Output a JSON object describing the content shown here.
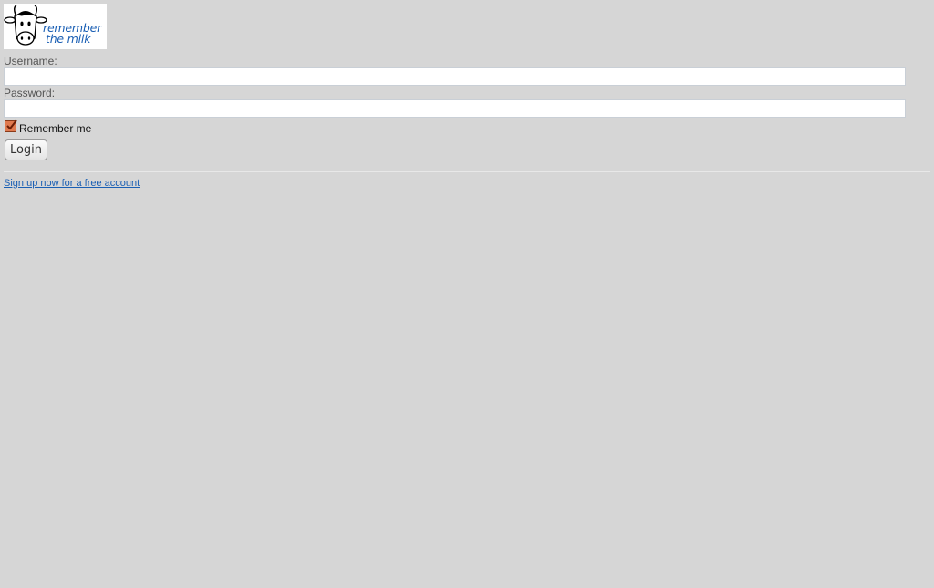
{
  "brand": {
    "logo_line1": "remember",
    "logo_line2": "the milk",
    "logo_icon": "cow-icon",
    "color": "#1a5fb4"
  },
  "login_form": {
    "username_label": "Username:",
    "username_value": "",
    "password_label": "Password:",
    "password_value": "",
    "remember_label": "Remember me",
    "remember_checked": true,
    "submit_label": "Login"
  },
  "footer": {
    "signup_link": "Sign up now for a free account"
  },
  "colors": {
    "background": "#d6d6d6",
    "link": "#1a5fb4",
    "checkbox": "#e07a4f"
  }
}
